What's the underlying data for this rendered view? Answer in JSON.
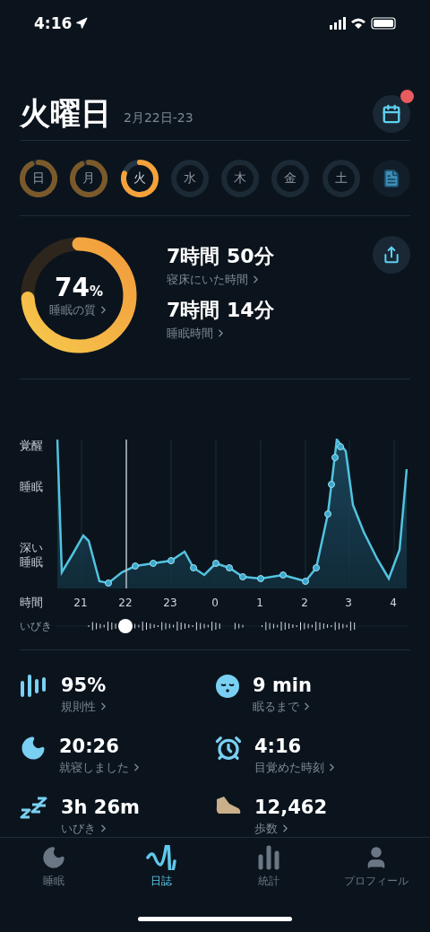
{
  "status_bar": {
    "time": "4:16"
  },
  "header": {
    "title": "火曜日",
    "date_range": "2月22日-23",
    "calendar_badge": true
  },
  "days": [
    {
      "label": "日",
      "has_data": true,
      "selected": false
    },
    {
      "label": "月",
      "has_data": true,
      "selected": false
    },
    {
      "label": "火",
      "has_data": true,
      "selected": true
    },
    {
      "label": "水",
      "has_data": false,
      "selected": false
    },
    {
      "label": "木",
      "has_data": false,
      "selected": false
    },
    {
      "label": "金",
      "has_data": false,
      "selected": false
    },
    {
      "label": "土",
      "has_data": false,
      "selected": false
    }
  ],
  "summary": {
    "quality": {
      "value": "74",
      "unit": "%",
      "label": "睡眠の質"
    },
    "metrics": [
      {
        "value": "7時間 50分",
        "label": "寝床にいた時間"
      },
      {
        "value": "7時間 14分",
        "label": "睡眠時間"
      }
    ]
  },
  "sleep_graph": {
    "y_labels": [
      "覚醒",
      "睡眠",
      "深い睡眠"
    ],
    "x_label": "時間",
    "x_ticks": [
      "21",
      "22",
      "23",
      "0",
      "1",
      "2",
      "3",
      "4"
    ],
    "snore_label": "いびき"
  },
  "stats": [
    {
      "kind": "regularity",
      "value": "95%",
      "label": "規則性"
    },
    {
      "kind": "fall-asleep",
      "value": "9 min",
      "label": "眠るまで"
    },
    {
      "kind": "bedtime",
      "value": "20:26",
      "label": "就寝しました"
    },
    {
      "kind": "wake",
      "value": "4:16",
      "label": "目覚めた時刻"
    },
    {
      "kind": "snore",
      "value": "3h 26m",
      "label": "いびき"
    },
    {
      "kind": "steps",
      "value": "12,462",
      "label": "歩数"
    }
  ],
  "tab_bar": [
    {
      "kind": "sleep",
      "label": "睡眠",
      "selected": false
    },
    {
      "kind": "journal",
      "label": "日誌",
      "selected": true
    },
    {
      "kind": "stats",
      "label": "統計",
      "selected": false
    },
    {
      "kind": "profile",
      "label": "プロフィール",
      "selected": false
    }
  ]
}
